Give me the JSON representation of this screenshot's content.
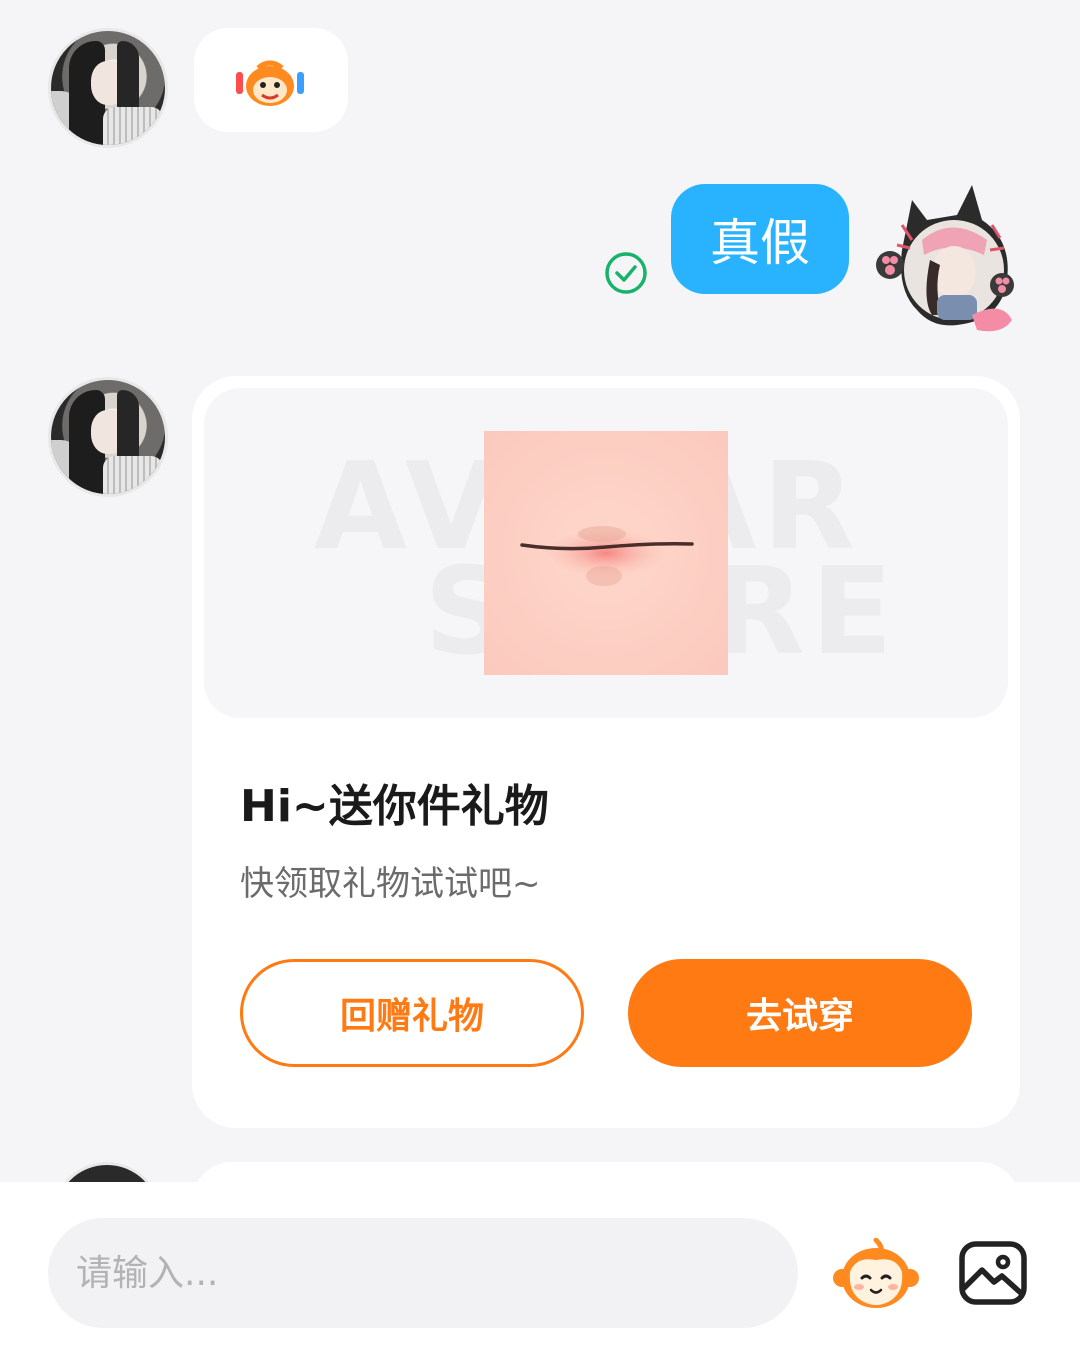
{
  "messages": [
    {
      "side": "left",
      "type": "sticker",
      "sticker_icon": "monkey-mascot-sticker-icon"
    },
    {
      "side": "right",
      "type": "text",
      "text": "真假",
      "status_icon": "check-circle-icon",
      "bubble_color": "#29b3ff"
    },
    {
      "side": "left",
      "type": "gift-card",
      "preview_watermark": [
        "AVATAR",
        "STORE"
      ],
      "title": "Hi~送你件礼物",
      "subtitle": "快领取礼物试试吧~",
      "buttons": {
        "return_gift": "回赠礼物",
        "try_on": "去试穿"
      }
    }
  ],
  "input_bar": {
    "placeholder": "请输入...",
    "mascot_icon": "mascot-face-icon",
    "image_icon": "image-icon"
  },
  "colors": {
    "background": "#f5f5f7",
    "bubble_blue": "#29b3ff",
    "accent_orange": "#ff7a12",
    "check_green": "#17b36b"
  }
}
